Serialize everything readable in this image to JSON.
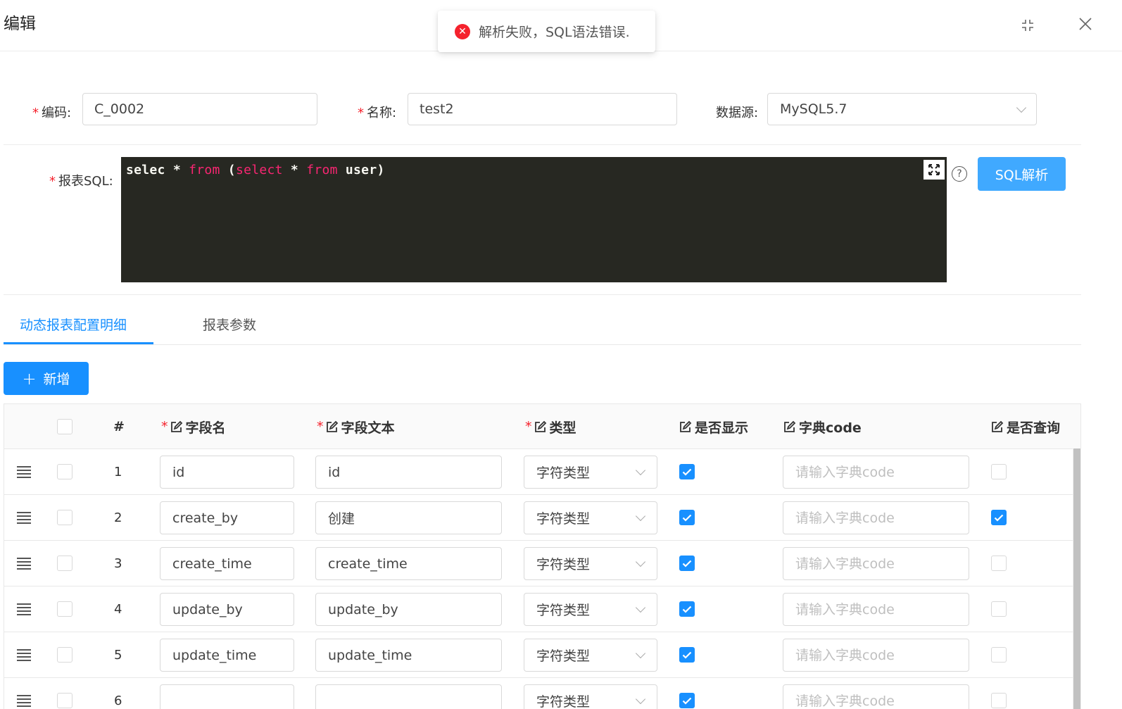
{
  "modal": {
    "title": "编辑"
  },
  "toast": {
    "message": "解析失败，SQL语法错误."
  },
  "form": {
    "code": {
      "label": "编码:",
      "value": "C_0002"
    },
    "name": {
      "label": "名称:",
      "value": "test2"
    },
    "datasource": {
      "label": "数据源:",
      "value": "MySQL5.7"
    },
    "sql": {
      "label": "报表SQL:",
      "tokens": [
        {
          "text": "selec * ",
          "kw": false
        },
        {
          "text": "from",
          "kw": true
        },
        {
          "text": " (",
          "kw": false
        },
        {
          "text": "select",
          "kw": true
        },
        {
          "text": " * ",
          "kw": false
        },
        {
          "text": "from",
          "kw": true
        },
        {
          "text": " user)",
          "kw": false
        }
      ],
      "parse_button": "SQL解析"
    }
  },
  "tabs": [
    {
      "label": "动态报表配置明细",
      "active": true
    },
    {
      "label": "报表参数",
      "active": false
    }
  ],
  "add_button": {
    "label": "新增"
  },
  "table": {
    "headers": {
      "index": "#",
      "field_name": "字段名",
      "field_text": "字段文本",
      "type": "类型",
      "is_show": "是否显示",
      "dict_code": "字典code",
      "is_query": "是否查询"
    },
    "dict_placeholder": "请输入字典code",
    "rows": [
      {
        "index": "1",
        "field_name": "id",
        "field_text": "id",
        "type": "字符类型",
        "is_show": true,
        "is_query": false
      },
      {
        "index": "2",
        "field_name": "create_by",
        "field_text": "创建",
        "type": "字符类型",
        "is_show": true,
        "is_query": true
      },
      {
        "index": "3",
        "field_name": "create_time",
        "field_text": "create_time",
        "type": "字符类型",
        "is_show": true,
        "is_query": false
      },
      {
        "index": "4",
        "field_name": "update_by",
        "field_text": "update_by",
        "type": "字符类型",
        "is_show": true,
        "is_query": false
      },
      {
        "index": "5",
        "field_name": "update_time",
        "field_text": "update_time",
        "type": "字符类型",
        "is_show": true,
        "is_query": false
      },
      {
        "index": "6",
        "field_name": "",
        "field_text": "",
        "type": "字符类型",
        "is_show": true,
        "is_query": false
      }
    ]
  },
  "colors": {
    "primary": "#1890ff",
    "light_primary": "#40a9ff",
    "error": "#f5222d",
    "editor_bg": "#272822",
    "keyword": "#f92672"
  }
}
